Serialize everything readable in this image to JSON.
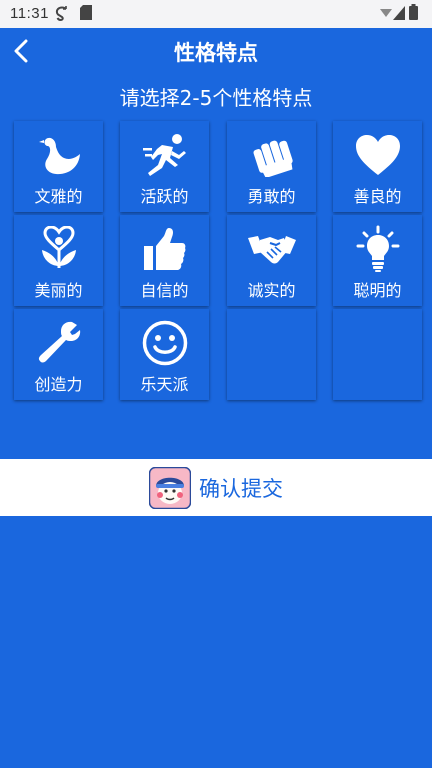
{
  "status_bar": {
    "time": "11:31",
    "icons": [
      "sync-icon",
      "sd-card-icon",
      "wifi-icon",
      "signal-icon",
      "battery-icon"
    ]
  },
  "app_bar": {
    "title": "性格特点",
    "back_icon": "back-arrow-icon"
  },
  "subtitle": "请选择2-5个性格特点",
  "traits": [
    {
      "label": "文雅的",
      "icon": "swan-icon"
    },
    {
      "label": "活跃的",
      "icon": "runner-icon"
    },
    {
      "label": "勇敢的",
      "icon": "fist-icon"
    },
    {
      "label": "善良的",
      "icon": "heart-icon"
    },
    {
      "label": "美丽的",
      "icon": "flower-heart-icon"
    },
    {
      "label": "自信的",
      "icon": "thumbs-up-icon"
    },
    {
      "label": "诚实的",
      "icon": "handshake-icon"
    },
    {
      "label": "聪明的",
      "icon": "lightbulb-icon"
    },
    {
      "label": "创造力",
      "icon": "wrench-icon"
    },
    {
      "label": "乐天派",
      "icon": "smiley-icon"
    }
  ],
  "confirm": {
    "label": "确认提交",
    "icon": "mascot-avatar-icon"
  },
  "colors": {
    "primary": "#1a67de",
    "white": "#ffffff",
    "status_bar": "#f4f4f6"
  }
}
